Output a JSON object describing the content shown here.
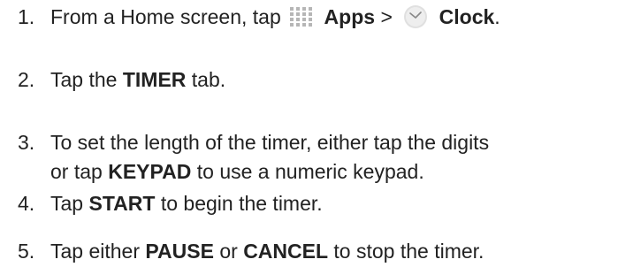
{
  "steps": [
    {
      "number": "1.",
      "text_1": "From a Home screen, tap",
      "apps_label": "Apps",
      "separator": ">",
      "clock_label": "Clock",
      "end": ".",
      "apps_icon": "apps-grid-icon",
      "clock_icon": "clock-icon"
    },
    {
      "number": "2.",
      "text_1": "Tap the",
      "bold_1": "TIMER",
      "text_2": "tab."
    },
    {
      "number": "3.",
      "line1": "To set the length of the timer, either tap the digits",
      "text_1": "or tap",
      "bold_1": "KEYPAD",
      "text_2": "to use a numeric keypad."
    },
    {
      "number": "4.",
      "text_1": "Tap",
      "bold_1": "START",
      "text_2": "to begin the timer."
    },
    {
      "number": "5.",
      "text_1": "Tap either",
      "bold_1": "PAUSE",
      "text_2": "or",
      "bold_2": "CANCEL",
      "text_3": "to stop the timer."
    }
  ],
  "colors": {
    "text": "#222222",
    "apps_icon_dot": "#b6b6b6",
    "clock_face": "#e0e0e0",
    "clock_hands": "#888888"
  }
}
